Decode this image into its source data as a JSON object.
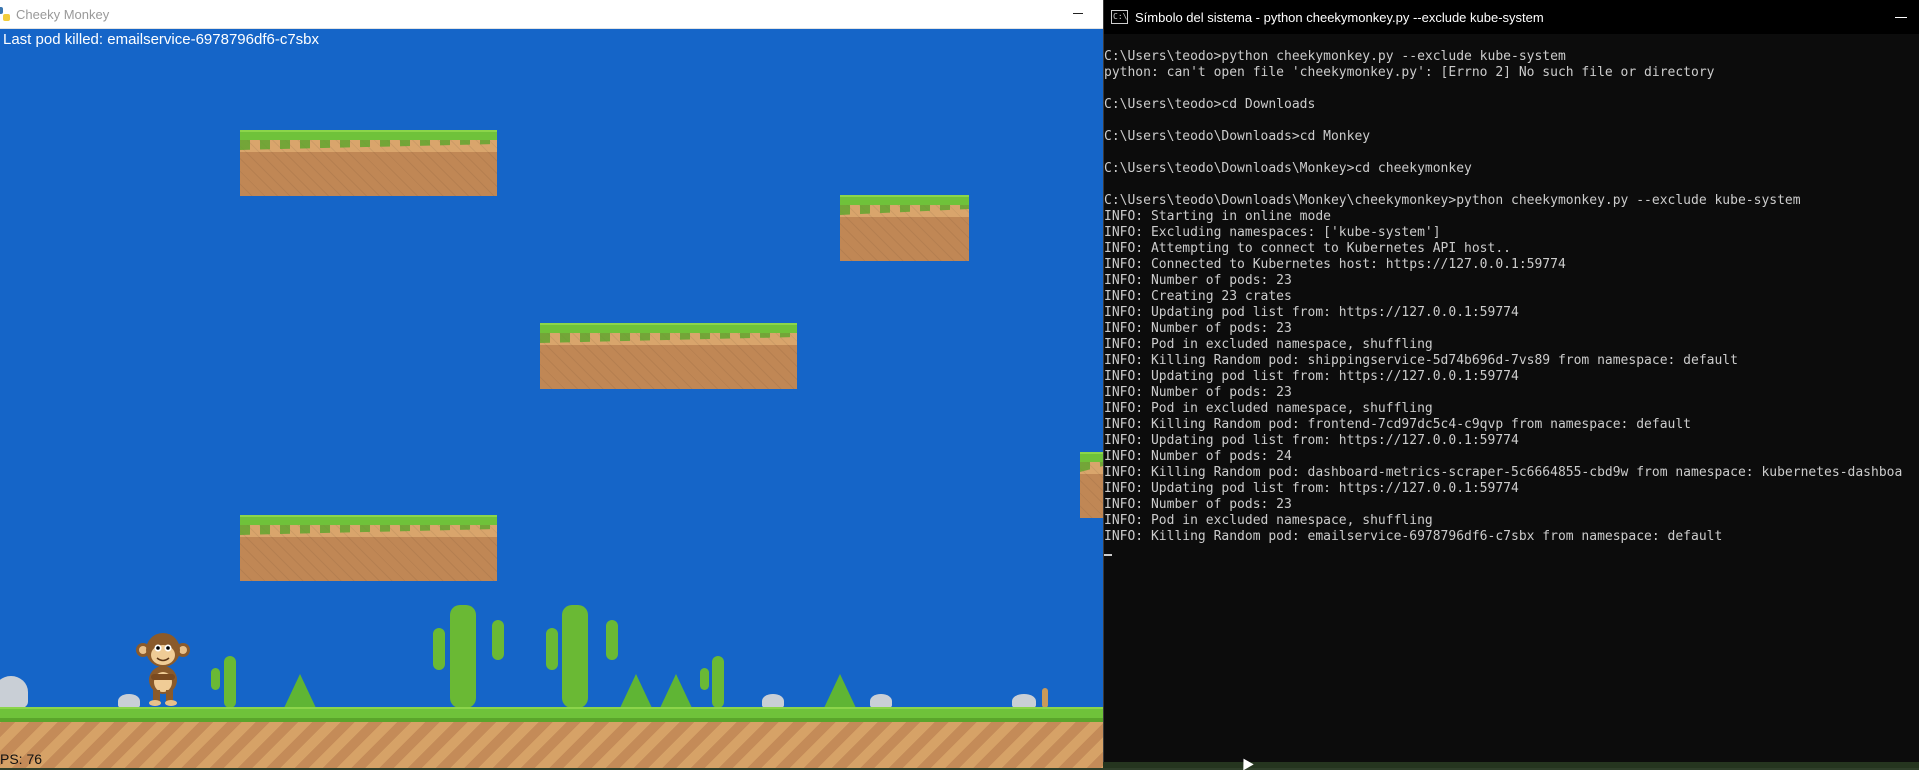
{
  "game": {
    "title": "Cheeky Monkey",
    "last_pod_label": "Last pod killed: emailservice-6978796df6-c7sbx",
    "fps": "PS:   76"
  },
  "console": {
    "title": "Símbolo del sistema - python  cheekymonkey.py --exclude kube-system",
    "icon_text": "C:\\",
    "lines": [
      "C:\\Users\\teodo>python cheekymonkey.py --exclude kube-system",
      "python: can't open file 'cheekymonkey.py': [Errno 2] No such file or directory",
      "",
      "C:\\Users\\teodo>cd Downloads",
      "",
      "C:\\Users\\teodo\\Downloads>cd Monkey",
      "",
      "C:\\Users\\teodo\\Downloads\\Monkey>cd cheekymonkey",
      "",
      "C:\\Users\\teodo\\Downloads\\Monkey\\cheekymonkey>python cheekymonkey.py --exclude kube-system",
      "INFO: Starting in online mode",
      "INFO: Excluding namespaces: ['kube-system']",
      "INFO: Attempting to connect to Kubernetes API host..",
      "INFO: Connected to Kubernetes host: https://127.0.0.1:59774",
      "INFO: Number of pods: 23",
      "INFO: Creating 23 crates",
      "INFO: Updating pod list from: https://127.0.0.1:59774",
      "INFO: Number of pods: 23",
      "INFO: Pod in excluded namespace, shuffling",
      "INFO: Killing Random pod: shippingservice-5d74b696d-7vs89 from namespace: default",
      "INFO: Updating pod list from: https://127.0.0.1:59774",
      "INFO: Number of pods: 23",
      "INFO: Pod in excluded namespace, shuffling",
      "INFO: Killing Random pod: frontend-7cd97dc5c4-c9qvp from namespace: default",
      "INFO: Updating pod list from: https://127.0.0.1:59774",
      "INFO: Number of pods: 24",
      "INFO: Killing Random pod: dashboard-metrics-scraper-5c6664855-cbd9w from namespace: kubernetes-dashboa",
      "INFO: Updating pod list from: https://127.0.0.1:59774",
      "INFO: Number of pods: 23",
      "INFO: Pod in excluded namespace, shuffling",
      "INFO: Killing Random pod: emailservice-6978796df6-c7sbx from namespace: default"
    ]
  },
  "colors": {
    "sky": "#1565c8",
    "grass": "#6fc23a",
    "dirt": "#d9a56c",
    "console_bg": "#0c0c0c",
    "console_text": "#cccccc"
  }
}
